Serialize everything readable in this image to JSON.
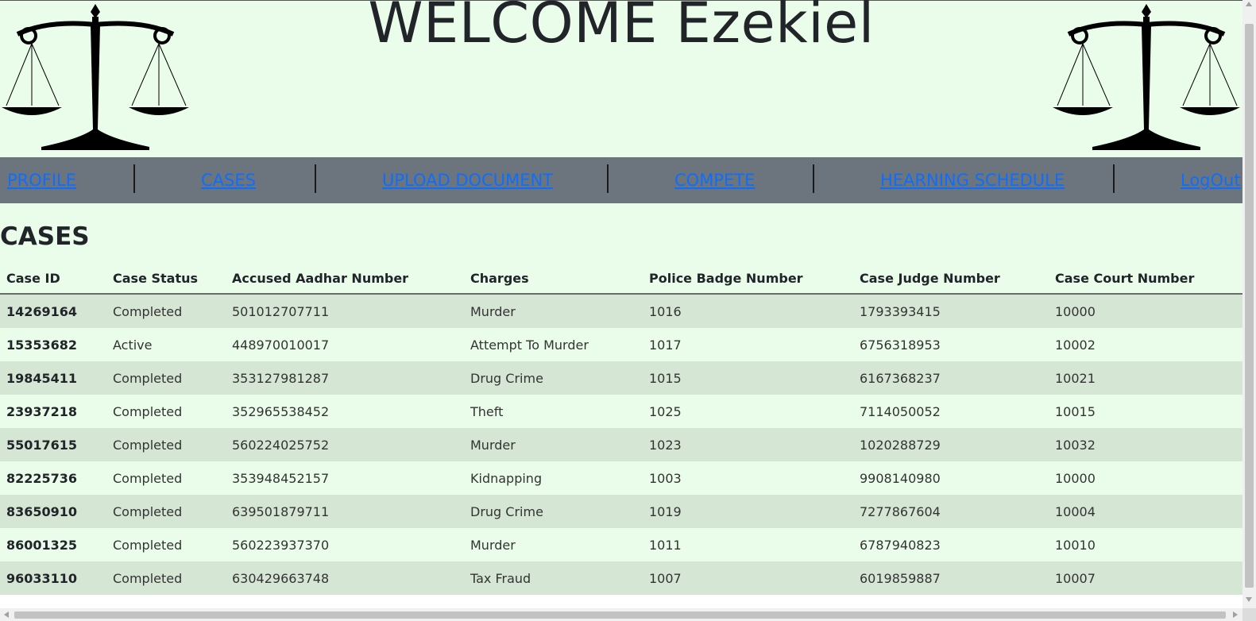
{
  "header": {
    "welcome_text": "WELCOME Ezekiel",
    "left_logo_icon": "scales-of-justice-icon",
    "right_logo_icon": "scales-of-justice-icon"
  },
  "nav": {
    "profile": "PROFILE",
    "cases": "CASES",
    "upload": "UPLOAD DOCUMENT",
    "compete": "COMPETE",
    "schedule": "HEARNING SCHEDULE",
    "logout": "LogOut"
  },
  "section_title": "CASES",
  "table": {
    "columns": [
      "Case ID",
      "Case Status",
      "Accused Aadhar Number",
      "Charges",
      "Police Badge Number",
      "Case Judge Number",
      "Case Court Number"
    ],
    "rows": [
      [
        "14269164",
        "Completed",
        "501012707711",
        "Murder",
        "1016",
        "1793393415",
        "10000"
      ],
      [
        "15353682",
        "Active",
        "448970010017",
        "Attempt To Murder",
        "1017",
        "6756318953",
        "10002"
      ],
      [
        "19845411",
        "Completed",
        "353127981287",
        "Drug Crime",
        "1015",
        "6167368237",
        "10021"
      ],
      [
        "23937218",
        "Completed",
        "352965538452",
        "Theft",
        "1025",
        "7114050052",
        "10015"
      ],
      [
        "55017615",
        "Completed",
        "560224025752",
        "Murder",
        "1023",
        "1020288729",
        "10032"
      ],
      [
        "82225736",
        "Completed",
        "353948452157",
        "Kidnapping",
        "1003",
        "9908140980",
        "10000"
      ],
      [
        "83650910",
        "Completed",
        "639501879711",
        "Drug Crime",
        "1019",
        "7277867604",
        "10004"
      ],
      [
        "86001325",
        "Completed",
        "560223937370",
        "Murder",
        "1011",
        "6787940823",
        "10010"
      ],
      [
        "96033110",
        "Completed",
        "630429663748",
        "Tax Fraud",
        "1007",
        "6019859887",
        "10007"
      ]
    ]
  },
  "colors": {
    "page_bg": "#eafdea",
    "stripe_bg": "#d5e6d5",
    "navbar_bg": "#6c757d",
    "link": "#0d6efd"
  }
}
